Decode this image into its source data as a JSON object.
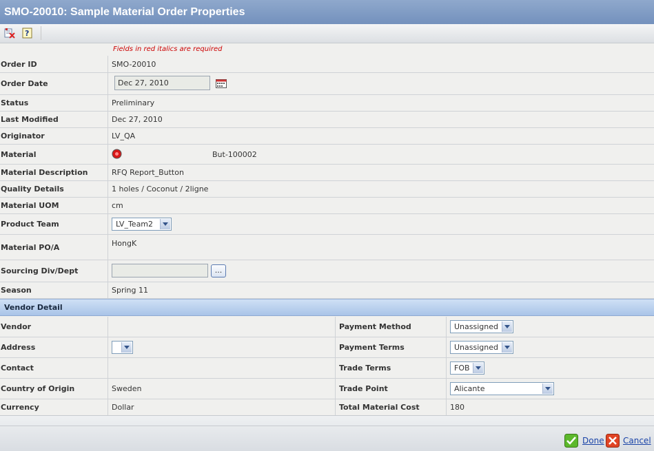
{
  "window": {
    "title": "SMO-20010: Sample Material Order Properties"
  },
  "toolbar": {
    "icons": [
      "edit-clear-icon",
      "help-icon"
    ]
  },
  "required_note": "Fields in red italics are required",
  "fields": {
    "order_id": {
      "label": "Order ID",
      "value": "SMO-20010"
    },
    "order_date": {
      "label": "Order Date",
      "value": "Dec 27, 2010"
    },
    "status": {
      "label": "Status",
      "value": "Preliminary"
    },
    "last_modified": {
      "label": "Last Modified",
      "value": "Dec 27, 2010"
    },
    "originator": {
      "label": "Originator",
      "value": "LV_QA"
    },
    "material": {
      "label": "Material",
      "value": "But-100002"
    },
    "material_description": {
      "label": "Material Description",
      "value": "RFQ Report_Button"
    },
    "quality_details": {
      "label": "Quality Details",
      "value": "1 holes / Coconut / 2ligne"
    },
    "material_uom": {
      "label": "Material UOM",
      "value": "cm"
    },
    "product_team": {
      "label": "Product Team",
      "value": "LV_Team2"
    },
    "material_poa": {
      "label": "Material PO/A",
      "value": "HongK"
    },
    "sourcing": {
      "label": "Sourcing Div/Dept",
      "value": "",
      "browse": "..."
    },
    "season": {
      "label": "Season",
      "value": "Spring 11"
    }
  },
  "vendor_section": {
    "title": "Vendor Detail",
    "vendor": {
      "label": "Vendor",
      "value": ""
    },
    "address": {
      "label": "Address",
      "value": ""
    },
    "contact": {
      "label": "Contact",
      "value": ""
    },
    "country": {
      "label": "Country of Origin",
      "value": "Sweden"
    },
    "currency": {
      "label": "Currency",
      "value": "Dollar"
    },
    "payment_method": {
      "label": "Payment Method",
      "value": "Unassigned"
    },
    "payment_terms": {
      "label": "Payment Terms",
      "value": "Unassigned"
    },
    "trade_terms": {
      "label": "Trade Terms",
      "value": "FOB"
    },
    "trade_point": {
      "label": "Trade Point",
      "value": "Alicante"
    },
    "total_cost": {
      "label": "Total Material Cost",
      "value": "180"
    }
  },
  "footer": {
    "done": "Done",
    "cancel": "Cancel"
  },
  "colors": {
    "title_bar": "#7f9bc4",
    "section_bar": "#b9d0ee",
    "required": "#cc0000",
    "link": "#1a44a8"
  }
}
